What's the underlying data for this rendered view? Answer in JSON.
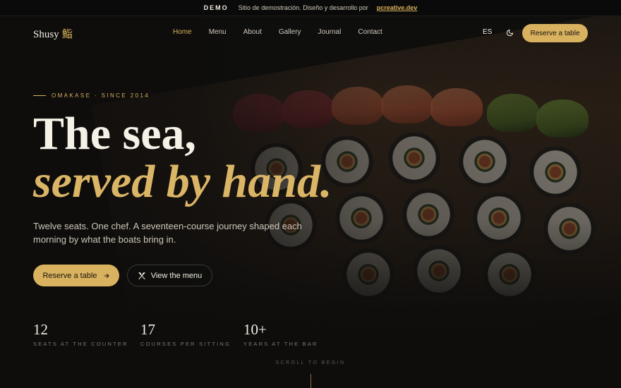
{
  "demo_bar": {
    "tag": "DEMO",
    "text": "Sitio de demostración. Diseño y desarrollo por",
    "link": "pcreative.dev"
  },
  "header": {
    "logo": "Shusy",
    "logo_kanji": "鮨",
    "nav": [
      "Home",
      "Menu",
      "About",
      "Gallery",
      "Journal",
      "Contact"
    ],
    "active_nav": "Home",
    "lang": "ES",
    "theme_icon": "moon-icon",
    "reserve": "Reserve a table"
  },
  "hero": {
    "eyebrow": "OMAKASE · SINCE 2014",
    "title_line1": "The sea,",
    "title_line2": "served by hand.",
    "lede": "Twelve seats. One chef. A seventeen-course journey shaped each morning by what the boats bring in.",
    "primary_cta": "Reserve a table",
    "primary_icon": "arrow-right-icon",
    "secondary_cta": "View the menu",
    "secondary_icon": "utensils-icon"
  },
  "stats": [
    {
      "value": "12",
      "label": "SEATS AT THE COUNTER"
    },
    {
      "value": "17",
      "label": "COURSES PER SITTING"
    },
    {
      "value": "10+",
      "label": "YEARS AT THE BAR"
    }
  ],
  "scroll_hint": "SCROLL TO BEGIN",
  "colors": {
    "accent": "#d9b25f",
    "background": "#0e0d0c",
    "text": "#f3ede2"
  }
}
